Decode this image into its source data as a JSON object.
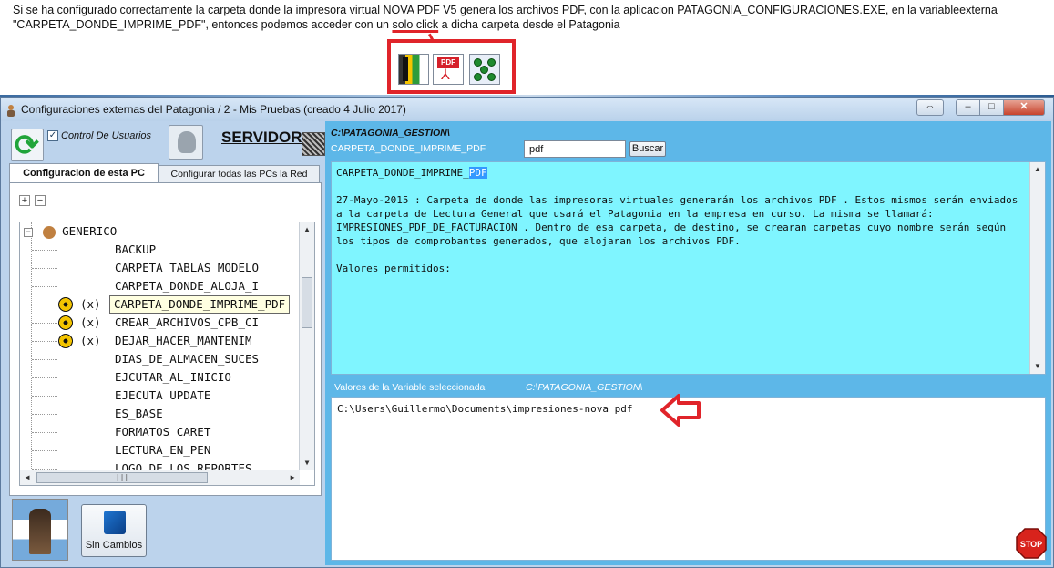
{
  "caption": {
    "line1_pre": "Si se ha configurado correctamente la carpeta donde la impresora virtual NOVA PDF V5 genera los archivos PDF, con la aplicacion PATAGONIA_CONFIGURACIONES.EXE, en la variableexterna",
    "line2_pre": "\"CARPETA_DONDE_IMPRIME_PDF\", entonces podemos acceder con un ",
    "line2_underlined": "solo click",
    "line2_post": " a dicha carpeta desde el Patagonia"
  },
  "toolbar_icons": [
    "battery-icon",
    "pdf-icon",
    "network-icon"
  ],
  "toolbar_pdf_label": "PDF",
  "window": {
    "title": "Configuraciones externas del Patagonia / 2 - Mis Pruebas (creado 4 Julio 2017)",
    "restore_glyph": "⇔",
    "min_glyph": "–",
    "max_glyph": "□",
    "close_glyph": "✕"
  },
  "left": {
    "checkbox_label": "Control De Usuarios",
    "checkbox_checked": "✓",
    "servidor": "SERVIDOR",
    "tab_active": "Configuracion de esta PC",
    "tab_inactive": "Configurar todas las PCs la Red",
    "expand": "+",
    "collapse": "−",
    "tree_root": "GENERICO",
    "tree_items": [
      {
        "prefix": "",
        "label": "BACKUP"
      },
      {
        "prefix": "",
        "label": "CARPETA TABLAS MODELO"
      },
      {
        "prefix": "",
        "label": "CARPETA_DONDE_ALOJA_I"
      },
      {
        "prefix": "(x)",
        "label": "CARPETA_DONDE_IMPRIME_PDF"
      },
      {
        "prefix": "(x)",
        "label": "CREAR_ARCHIVOS_CPB_CI"
      },
      {
        "prefix": "(x)",
        "label": "DEJAR_HACER_MANTENIM"
      },
      {
        "prefix": "",
        "label": "DIAS_DE_ALMACEN_SUCES"
      },
      {
        "prefix": "",
        "label": "EJCUTAR_AL_INICIO"
      },
      {
        "prefix": "",
        "label": "EJECUTA UPDATE"
      },
      {
        "prefix": "",
        "label": "ES_BASE"
      },
      {
        "prefix": "",
        "label": "FORMATOS CARET"
      },
      {
        "prefix": "",
        "label": "LECTURA_EN_PEN"
      },
      {
        "prefix": "",
        "label": "LOGO_DE_LOS_REPORTES"
      }
    ],
    "sin_cambios": "Sin Cambios"
  },
  "right": {
    "path": "C:\\PATAGONIA_GESTION\\",
    "variable": "CARPETA_DONDE_IMPRIME_PDF",
    "search_value": "pdf",
    "search_button": "Buscar",
    "desc_title_pre": "CARPETA_DONDE_IMPRIME_",
    "desc_title_hl": "PDF",
    "desc_body": "27-Mayo-2015 : Carpeta de donde las impresoras virtuales generarán los archivos PDF . Estos mismos serán enviados a la carpeta de Lectura General que usará el Patagonia en la empresa en curso. La misma se llamará: IMPRESIONES_PDF_DE_FACTURACION . Dentro de esa carpeta, de destino, se crearan carpetas cuyo nombre serán según los tipos de comprobantes generados, que alojaran los archivos PDF.",
    "desc_allowed": "Valores permitidos:",
    "values_label": "Valores de la Variable seleccionada",
    "values_path": "C:\\PATAGONIA_GESTION\\",
    "value": "C:\\Users\\Guillermo\\Documents\\impresiones-nova pdf",
    "stop_label": "STOP"
  },
  "scroll": {
    "up": "▲",
    "down": "▼",
    "left": "◀",
    "right": "▶",
    "grip": "|||"
  },
  "colors": {
    "accent_red": "#e0242a",
    "client_bg": "#5db7e8",
    "desc_bg": "#7ff5ff",
    "selection": "#3399ff"
  }
}
